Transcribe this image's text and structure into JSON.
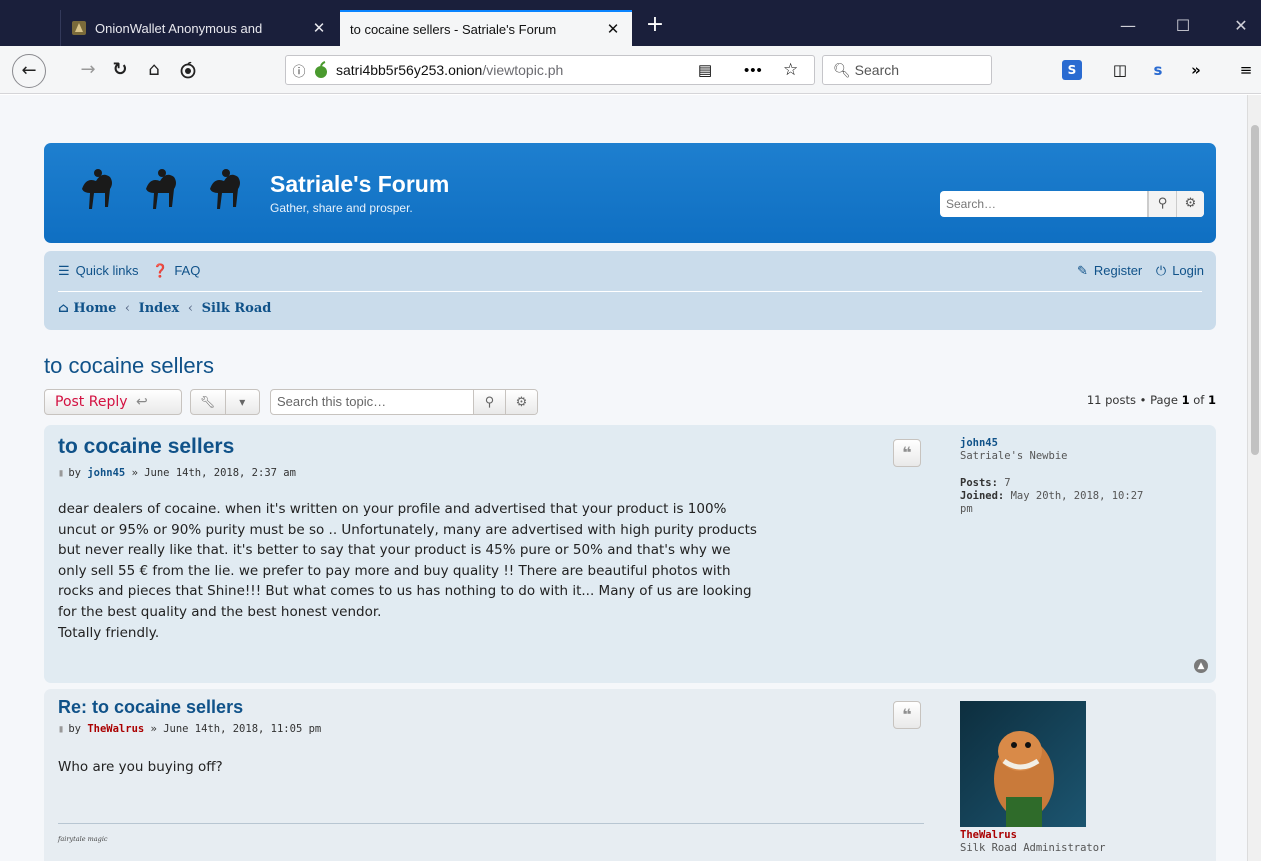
{
  "browser": {
    "tabs": [
      {
        "title": "OnionWallet Anonymous and ",
        "active": false
      },
      {
        "title": "to cocaine sellers - Satriale's Forum",
        "active": true
      }
    ],
    "new_tab": "+",
    "window_buttons": {
      "minimize": "—",
      "maximize": "☐",
      "close": "✕"
    },
    "url": {
      "host": "satri4bb5r56y253.onion",
      "path": "/viewtopic.ph"
    },
    "search_placeholder": "Search"
  },
  "forum": {
    "site_title": "Satriale's Forum",
    "site_description": "Gather, share and prosper.",
    "header_search_placeholder": "Search…",
    "nav": {
      "quick_links": "Quick links",
      "faq": "FAQ",
      "register": "Register",
      "login": "Login"
    },
    "breadcrumbs": [
      "Home",
      "Index",
      "Silk Road"
    ],
    "topic_title": "to cocaine sellers",
    "actions": {
      "post_reply": "Post Reply",
      "topic_search_placeholder": "Search this topic…"
    },
    "pagination": {
      "posts": "11 posts",
      "page_text": "Page",
      "current": "1",
      "of": "of",
      "total": "1"
    },
    "posts": [
      {
        "title": "to cocaine sellers",
        "by": "by",
        "author": "john45",
        "date": "» June 14th, 2018, 2:37 am",
        "body": [
          "dear dealers of cocaine. when it's written on your profile and advertised that your product is 100%",
          "uncut or 95% or 90% purity must be so .. Unfortunately, many are advertised with high purity products",
          "but never really like that. it's better to say that your product is 45% pure or 50% and that's why we",
          "only sell 55 € from the lie. we prefer to pay more and buy quality !! There are beautiful photos with",
          "rocks and pieces that Shine!!! But what comes to us has nothing to do with it... Many of us are looking",
          "for the best quality and the best honest vendor.",
          "Totally friendly."
        ],
        "profile": {
          "username": "john45",
          "rank": "Satriale's Newbie",
          "posts_label": "Posts:",
          "posts": "7",
          "joined_label": "Joined:",
          "joined": "May 20th, 2018, 10:27",
          "joined_cont": "pm"
        }
      },
      {
        "title": "Re: to cocaine sellers",
        "by": "by",
        "author": "TheWalrus",
        "date": "» June 14th, 2018, 11:05 pm",
        "body": [
          "Who are you buying off?"
        ],
        "signature": "fairytale magic",
        "profile": {
          "username": "TheWalrus",
          "rank": "Silk Road Administrator"
        }
      }
    ]
  },
  "colors": {
    "header_blue": "#1e7fcf",
    "nav_panel": "#cadceb",
    "post_bg": "#e1ebf2",
    "link_blue": "#105289",
    "reply_red": "#d31141",
    "admin_red": "#aa0000"
  }
}
